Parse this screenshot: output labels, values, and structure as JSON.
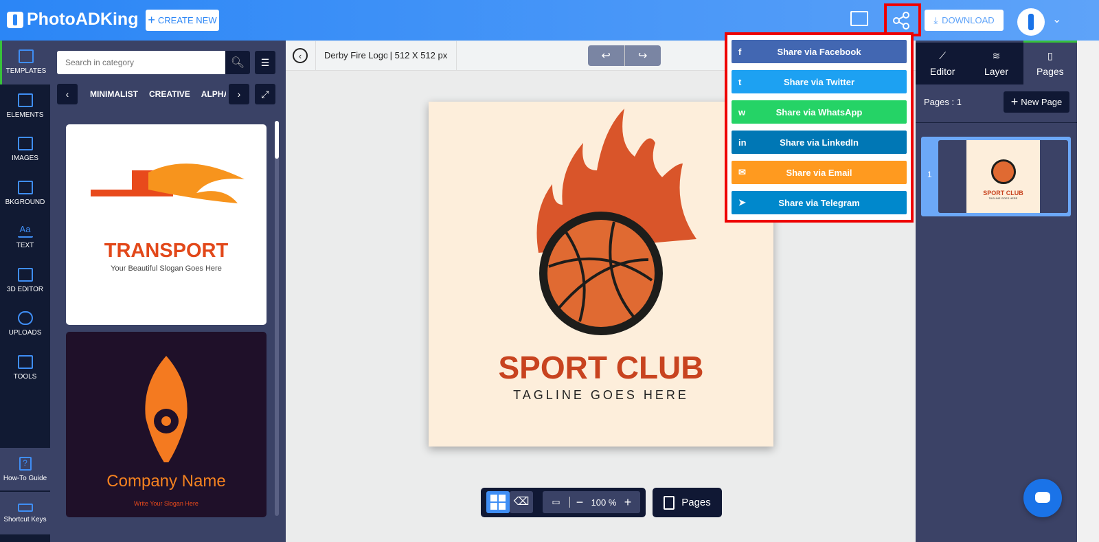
{
  "header": {
    "brand": "PhotoADKing",
    "create_new": "CREATE NEW",
    "download": "DOWNLOAD"
  },
  "left_nav": {
    "items": [
      {
        "label": "TEMPLATES",
        "active": true
      },
      {
        "label": "ELEMENTS"
      },
      {
        "label": "IMAGES"
      },
      {
        "label": "BKGROUND"
      },
      {
        "label": "TEXT"
      },
      {
        "label": "3D EDITOR"
      },
      {
        "label": "UPLOADS"
      },
      {
        "label": "TOOLS"
      }
    ],
    "how_to": "How-To Guide",
    "shortcuts": "Shortcut Keys"
  },
  "templates_panel": {
    "search_placeholder": "Search in category",
    "categories": [
      "MINIMALIST",
      "CREATIVE",
      "ALPHABET"
    ],
    "cards": [
      {
        "title": "TRANSPORT",
        "slogan": "Your Beautiful Slogan Goes Here"
      },
      {
        "title": "Company Name",
        "slogan": "Write Your Slogan Here"
      }
    ]
  },
  "toolbar": {
    "file_name": "Derby Fire Logo",
    "size": "| 512 X 512 px"
  },
  "canvas": {
    "title": "SPORT CLUB",
    "tagline": "TAGLINE GOES HERE",
    "bg": "#fdeedb",
    "accent": "#c8431f"
  },
  "bottom": {
    "zoom": "100 %",
    "pages": "Pages"
  },
  "share_menu": [
    {
      "label": "Share via Facebook",
      "icon": "f",
      "color": "#4267b2"
    },
    {
      "label": "Share via Twitter",
      "icon": "t",
      "color": "#1da1f2"
    },
    {
      "label": "Share via WhatsApp",
      "icon": "w",
      "color": "#25d366"
    },
    {
      "label": "Share via LinkedIn",
      "icon": "in",
      "color": "#0077b5"
    },
    {
      "label": "Share via Email",
      "icon": "✉",
      "color": "#ff9a1f"
    },
    {
      "label": "Share via Telegram",
      "icon": "➤",
      "color": "#0088cc"
    }
  ],
  "right_panel": {
    "tabs": [
      "Editor",
      "Layer",
      "Pages"
    ],
    "pages_count": "Pages : 1",
    "new_page": "New Page",
    "page_number": "1",
    "thumb_title": "SPORT CLUB",
    "thumb_tagline": "TAGLINE GOES HERE"
  }
}
